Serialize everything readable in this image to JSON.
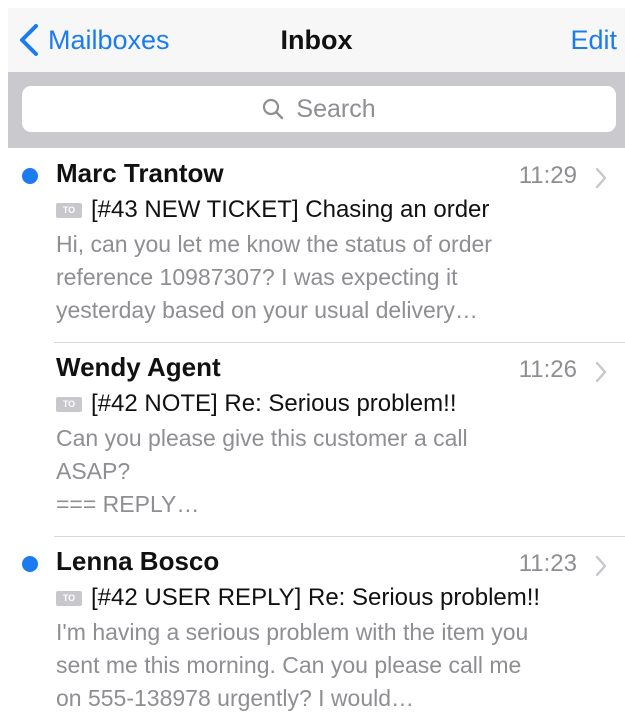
{
  "navbar": {
    "back_label": "Mailboxes",
    "title": "Inbox",
    "edit_label": "Edit"
  },
  "search": {
    "placeholder": "Search"
  },
  "colors": {
    "accent": "#1a7cf0",
    "unread_dot": "#1a7cf0",
    "secondary_text": "#8e8e93",
    "search_bar_background": "#c9c9ce"
  },
  "messages": [
    {
      "sender": "Marc Trantow",
      "time": "11:29",
      "unread": true,
      "to_badge": "TO",
      "subject": "[#43 NEW TICKET] Chasing an order",
      "preview": "Hi, can you let me know the status of order\nreference 10987307? I was expecting it\nyesterday based on your usual delivery…"
    },
    {
      "sender": "Wendy Agent",
      "time": "11:26",
      "unread": false,
      "to_badge": "TO",
      "subject": "[#42 NOTE] Re: Serious problem!!",
      "preview": "Can you please give this customer a call\nASAP?\n=== REPLY…"
    },
    {
      "sender": "Lenna Bosco",
      "time": "11:23",
      "unread": true,
      "to_badge": "TO",
      "subject": "[#42 USER REPLY] Re: Serious problem!!",
      "preview": "I'm having a serious problem with the item you\nsent me this morning. Can you please call me\non 555-138978 urgently? I would…"
    }
  ]
}
